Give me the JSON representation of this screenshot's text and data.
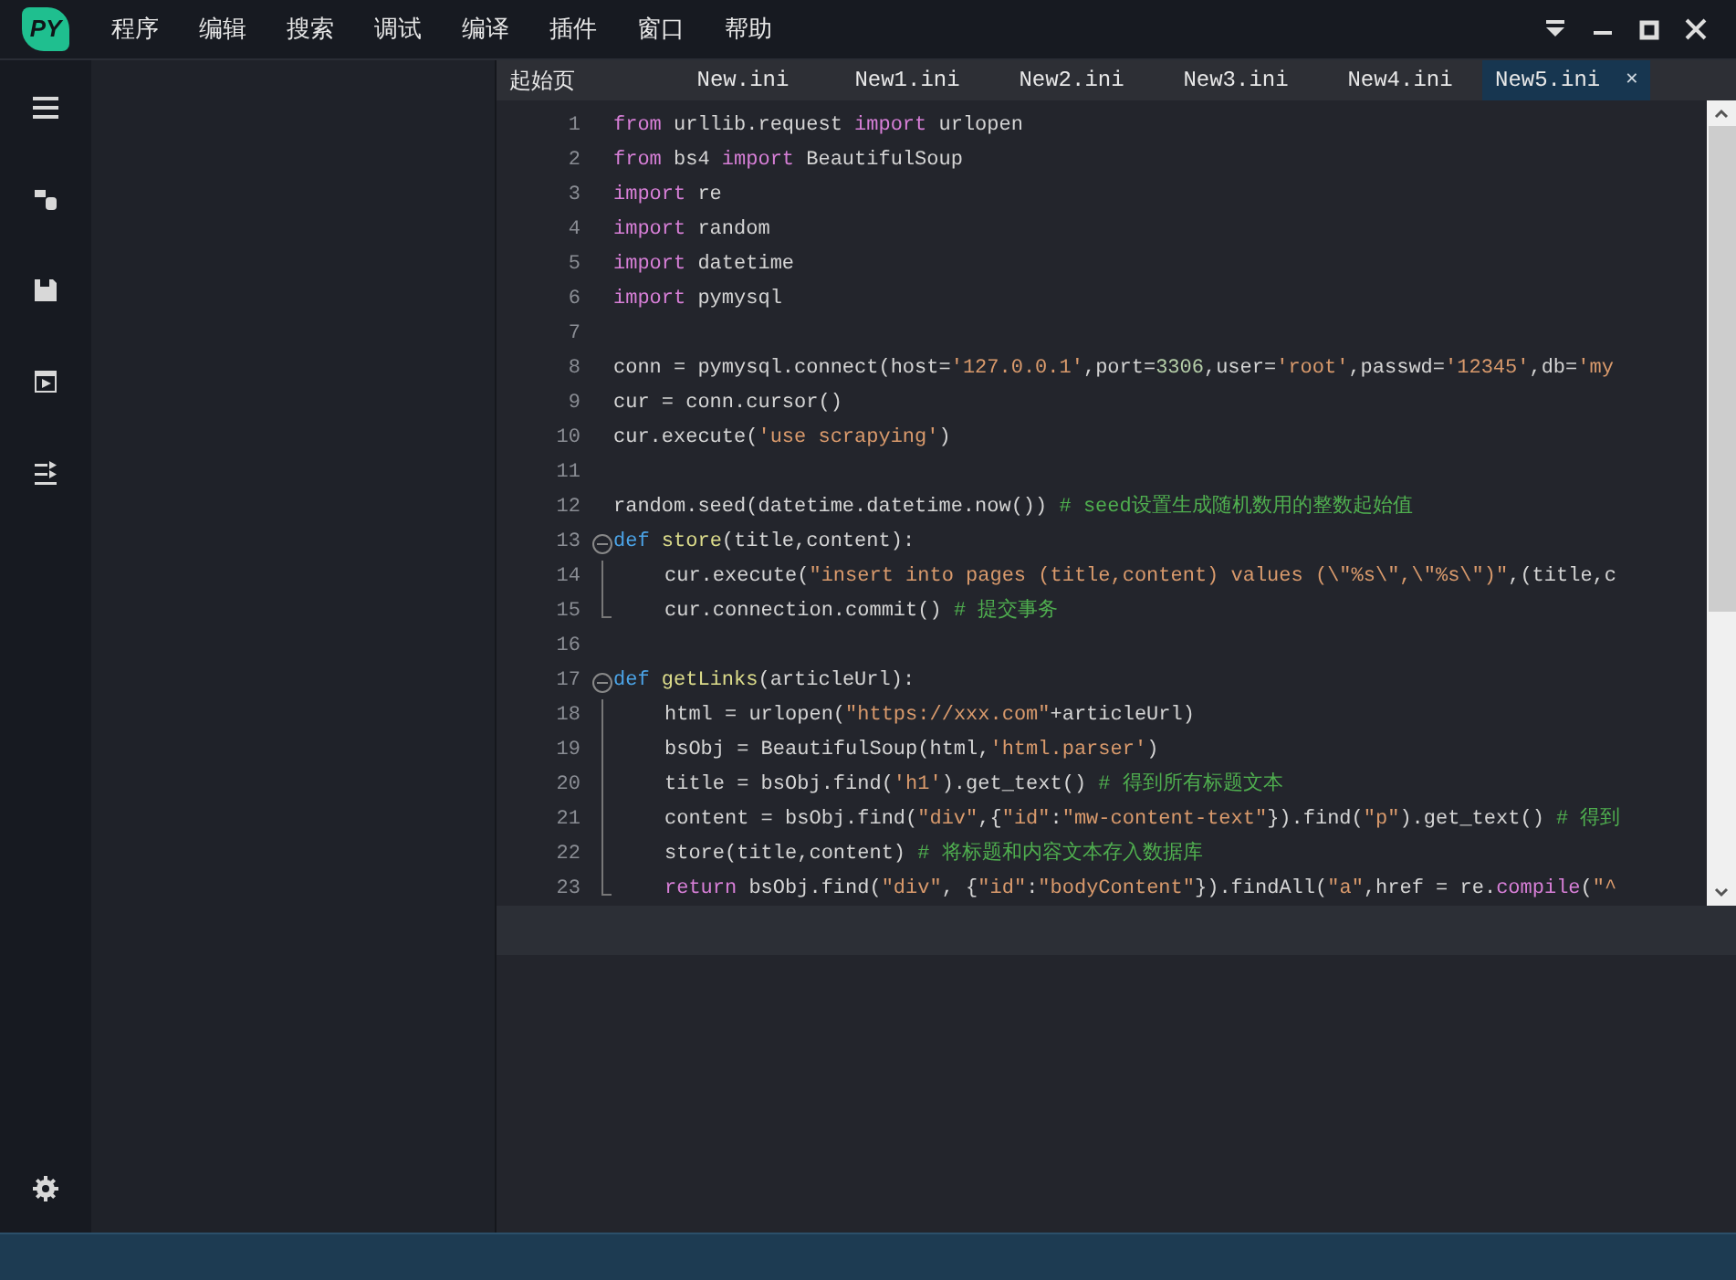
{
  "app": {
    "logo": "PY"
  },
  "menu": [
    "程序",
    "编辑",
    "搜索",
    "调试",
    "编译",
    "插件",
    "窗口",
    "帮助"
  ],
  "tabs": [
    {
      "label": "起始页",
      "selected": false,
      "closable": false
    },
    {
      "label": "New.ini",
      "selected": false,
      "closable": false
    },
    {
      "label": "New1.ini",
      "selected": false,
      "closable": false
    },
    {
      "label": "New2.ini",
      "selected": false,
      "closable": false
    },
    {
      "label": "New3.ini",
      "selected": false,
      "closable": false
    },
    {
      "label": "New4.ini",
      "selected": false,
      "closable": false
    },
    {
      "label": "New5.ini",
      "selected": true,
      "closable": true
    }
  ],
  "close_glyph": "✕",
  "code": [
    {
      "number": "1",
      "indented": false,
      "tokens": [
        {
          "kind": "kw",
          "text": "from"
        },
        {
          "kind": "plain",
          "text": " urllib.request "
        },
        {
          "kind": "kw",
          "text": "import"
        },
        {
          "kind": "plain",
          "text": " urlopen"
        }
      ]
    },
    {
      "number": "2",
      "indented": false,
      "tokens": [
        {
          "kind": "kw",
          "text": "from"
        },
        {
          "kind": "plain",
          "text": " bs4 "
        },
        {
          "kind": "kw",
          "text": "import"
        },
        {
          "kind": "plain",
          "text": " BeautifulSoup"
        }
      ]
    },
    {
      "number": "3",
      "indented": false,
      "tokens": [
        {
          "kind": "kw",
          "text": "import"
        },
        {
          "kind": "plain",
          "text": " re"
        }
      ]
    },
    {
      "number": "4",
      "indented": false,
      "tokens": [
        {
          "kind": "kw",
          "text": "import"
        },
        {
          "kind": "plain",
          "text": " random"
        }
      ]
    },
    {
      "number": "5",
      "indented": false,
      "tokens": [
        {
          "kind": "kw",
          "text": "import"
        },
        {
          "kind": "plain",
          "text": " datetime"
        }
      ]
    },
    {
      "number": "6",
      "indented": false,
      "tokens": [
        {
          "kind": "kw",
          "text": "import"
        },
        {
          "kind": "plain",
          "text": " pymysql"
        }
      ]
    },
    {
      "number": "7"
    },
    {
      "number": "8",
      "indented": false,
      "tokens": [
        {
          "kind": "plain",
          "text": "conn = pymysql.connect(host="
        },
        {
          "kind": "str",
          "text": "'127.0.0.1'"
        },
        {
          "kind": "plain",
          "text": ",port="
        },
        {
          "kind": "num",
          "text": "3306"
        },
        {
          "kind": "plain",
          "text": ",user="
        },
        {
          "kind": "str",
          "text": "'root'"
        },
        {
          "kind": "plain",
          "text": ",passwd="
        },
        {
          "kind": "str",
          "text": "'12345'"
        },
        {
          "kind": "plain",
          "text": ",db="
        },
        {
          "kind": "str",
          "text": "'my"
        }
      ]
    },
    {
      "number": "9",
      "indented": false,
      "tokens": [
        {
          "kind": "plain",
          "text": "cur = conn.cursor()"
        }
      ]
    },
    {
      "number": "10",
      "indented": false,
      "tokens": [
        {
          "kind": "plain",
          "text": "cur.execute("
        },
        {
          "kind": "str",
          "text": "'use scrapying'"
        },
        {
          "kind": "plain",
          "text": ")"
        }
      ]
    },
    {
      "number": "11"
    },
    {
      "number": "12",
      "indented": false,
      "tokens": [
        {
          "kind": "plain",
          "text": "random.seed(datetime.datetime.now()) "
        },
        {
          "kind": "cm",
          "text": "# seed设置生成随机数用的整数起始值"
        }
      ]
    },
    {
      "number": "13",
      "indented": false,
      "kind": "fold_start",
      "tokens": [
        {
          "kind": "def",
          "text": "def"
        },
        {
          "kind": "fn",
          "text": " store"
        },
        {
          "kind": "plain",
          "text": "(title,content):"
        }
      ]
    },
    {
      "number": "14",
      "indented": true,
      "kind": "fold_line",
      "tokens": [
        {
          "kind": "plain",
          "text": "cur.execute("
        },
        {
          "kind": "str",
          "text": "\"insert into pages (title,content) values (\\\"%s\\\",\\\"%s\\\")\""
        },
        {
          "kind": "plain",
          "text": ",(title,c"
        }
      ]
    },
    {
      "number": "15",
      "indented": true,
      "kind": "fold_end",
      "tokens": [
        {
          "kind": "plain",
          "text": "cur.connection.commit() "
        },
        {
          "kind": "cm",
          "text": "# 提交事务"
        }
      ]
    },
    {
      "number": "16"
    },
    {
      "number": "17",
      "indented": false,
      "kind": "fold_start",
      "tokens": [
        {
          "kind": "def",
          "text": "def"
        },
        {
          "kind": "fn",
          "text": " getLinks"
        },
        {
          "kind": "plain",
          "text": "(articleUrl):"
        }
      ]
    },
    {
      "number": "18",
      "indented": true,
      "kind": "fold_line",
      "tokens": [
        {
          "kind": "plain",
          "text": "html = urlopen("
        },
        {
          "kind": "str",
          "text": "\"https://xxx.com\""
        },
        {
          "kind": "plain",
          "text": "+articleUrl)"
        }
      ]
    },
    {
      "number": "19",
      "indented": true,
      "kind": "fold_line",
      "tokens": [
        {
          "kind": "plain",
          "text": "bsObj = BeautifulSoup(html,"
        },
        {
          "kind": "str",
          "text": "'html.parser'"
        },
        {
          "kind": "plain",
          "text": ")"
        }
      ]
    },
    {
      "number": "20",
      "indented": true,
      "kind": "fold_line",
      "tokens": [
        {
          "kind": "plain",
          "text": "title = bsObj.find("
        },
        {
          "kind": "str",
          "text": "'h1'"
        },
        {
          "kind": "plain",
          "text": ").get_text() "
        },
        {
          "kind": "cm",
          "text": "# 得到所有标题文本"
        }
      ]
    },
    {
      "number": "21",
      "indented": true,
      "kind": "fold_line",
      "tokens": [
        {
          "kind": "plain",
          "text": "content = bsObj.find("
        },
        {
          "kind": "str",
          "text": "\"div\""
        },
        {
          "kind": "plain",
          "text": ",{"
        },
        {
          "kind": "str",
          "text": "\"id\""
        },
        {
          "kind": "plain",
          "text": ":"
        },
        {
          "kind": "str",
          "text": "\"mw-content-text\""
        },
        {
          "kind": "plain",
          "text": "}).find("
        },
        {
          "kind": "str",
          "text": "\"p\""
        },
        {
          "kind": "plain",
          "text": ").get_text() "
        },
        {
          "kind": "cm",
          "text": "# 得到"
        }
      ]
    },
    {
      "number": "22",
      "indented": true,
      "kind": "fold_line",
      "tokens": [
        {
          "kind": "plain",
          "text": "store(title,content) "
        },
        {
          "kind": "cm",
          "text": "# 将标题和内容文本存入数据库"
        }
      ]
    },
    {
      "number": "23",
      "indented": true,
      "kind": "fold_end",
      "tokens": [
        {
          "kind": "kw",
          "text": "return"
        },
        {
          "kind": "plain",
          "text": " bsObj.find("
        },
        {
          "kind": "str",
          "text": "\"div\""
        },
        {
          "kind": "plain",
          "text": ", {"
        },
        {
          "kind": "str",
          "text": "\"id\""
        },
        {
          "kind": "plain",
          "text": ":"
        },
        {
          "kind": "str",
          "text": "\"bodyContent\""
        },
        {
          "kind": "plain",
          "text": "}).findAll("
        },
        {
          "kind": "str",
          "text": "\"a\""
        },
        {
          "kind": "plain",
          "text": ",href = re."
        },
        {
          "kind": "kw",
          "text": "compile"
        },
        {
          "kind": "plain",
          "text": "("
        },
        {
          "kind": "str",
          "text": "\"^"
        }
      ]
    }
  ]
}
